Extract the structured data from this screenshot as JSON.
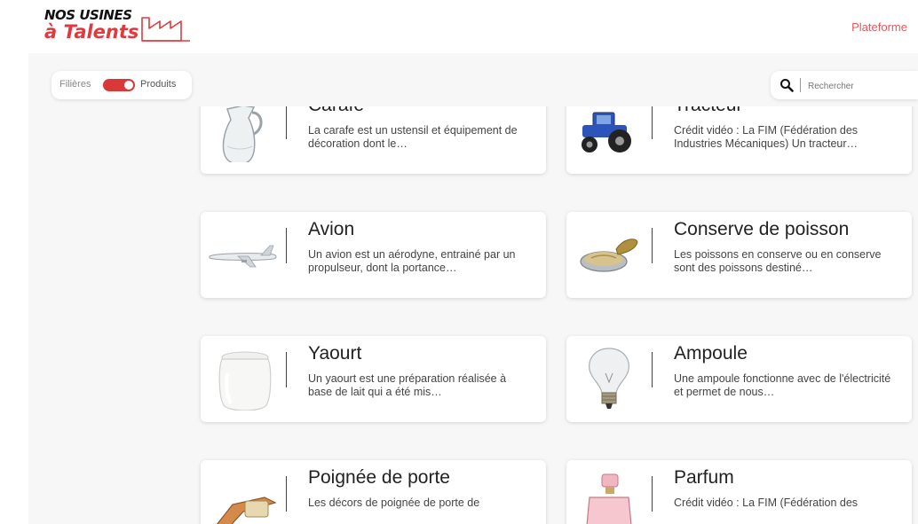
{
  "header": {
    "logo_line1": "NOS USINES",
    "logo_line2": "à Talents",
    "nav_link": "Plateforme",
    "accent": "#e03a3e"
  },
  "filter": {
    "left_label": "Filières",
    "right_label": "Produits",
    "switch_color": "#d93838"
  },
  "search": {
    "placeholder": "Rechercher",
    "icon": "search-icon"
  },
  "cards": [
    {
      "title": "Carafe",
      "desc": "La carafe est un ustensil et équipement de décoration dont le…",
      "icon": "carafe-image"
    },
    {
      "title": "Tracteur",
      "desc": "Crédit vidéo : La FIM (Fédération des Industries Mécaniques) Un tracteur…",
      "icon": "tractor-image"
    },
    {
      "title": "Avion",
      "desc": "Un avion est un aérodyne, entrainé par un propulseur, dont la portance…",
      "icon": "airplane-image"
    },
    {
      "title": "Conserve de poisson",
      "desc": "Les poissons en conserve ou en conserve sont des poissons destiné…",
      "icon": "fish-can-image"
    },
    {
      "title": "Yaourt",
      "desc": "Un yaourt est une préparation réalisée à base de lait qui a été mis…",
      "icon": "yogurt-image"
    },
    {
      "title": "Ampoule",
      "desc": "Une ampoule fonctionne avec de l'électricité et permet de nous…",
      "icon": "light-bulb-image"
    },
    {
      "title": "Poignée de porte",
      "desc": "Les décors de poignée de porte de",
      "icon": "door-handle-image"
    },
    {
      "title": "Parfum",
      "desc": "Crédit vidéo : La FIM (Fédération des",
      "icon": "perfume-image"
    }
  ]
}
